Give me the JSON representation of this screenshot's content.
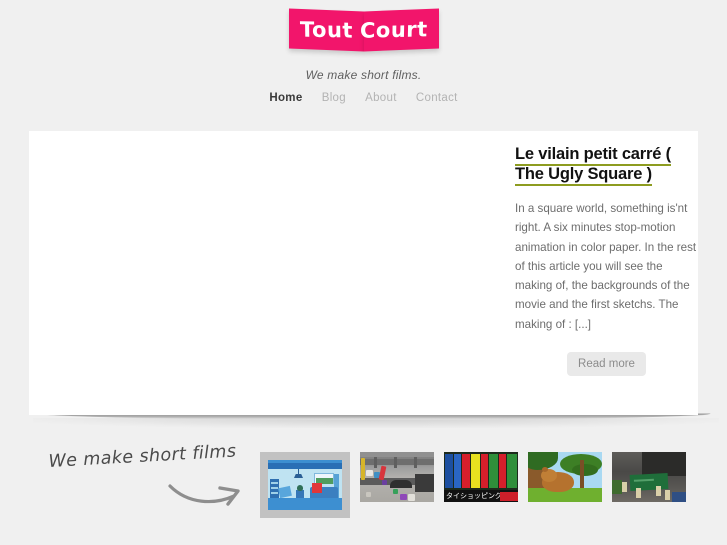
{
  "site": {
    "logo_text_part1": "Tout",
    "logo_text_part2": "Court",
    "logo_color": "#f2156b",
    "tagline": "We make short films.",
    "background_color": "#f0f0f0"
  },
  "nav": {
    "items": [
      {
        "label": "Home",
        "active": true
      },
      {
        "label": "Blog",
        "active": false
      },
      {
        "label": "About",
        "active": false
      },
      {
        "label": "Contact",
        "active": false
      }
    ],
    "active_color": "#3a3a3a",
    "inactive_color": "#b3b3b3"
  },
  "post": {
    "title": "Le vilain petit carré ( The Ugly Square )",
    "title_underline_color": "#8d9c20",
    "excerpt": "In a square world, something is'nt right. A six minutes stop-motion animation in color paper. In the rest of this article you will see the making of, the backgrounds of the movie and the first sketchs. The making of : [...]",
    "read_more_label": "Read more"
  },
  "promo": {
    "text": "We make short films",
    "arrow_icon": "curved-arrow-right"
  },
  "thumbnails": [
    {
      "name": "thumb-paper-living-room",
      "caption": "Blue paper-cut living room scene",
      "selected": true
    },
    {
      "name": "thumb-street-toys",
      "caption": "Grey street curb with colored toy figures",
      "selected": false
    },
    {
      "name": "thumb-japanese-signage",
      "caption": "Japanese shop signage",
      "selected": false,
      "sign_text": "タイショッピング"
    },
    {
      "name": "thumb-cartoon-bear",
      "caption": "Cartoon bear under green trees",
      "selected": false
    },
    {
      "name": "thumb-circuit-board",
      "caption": "Dark scene with green circuit board",
      "selected": false
    }
  ]
}
